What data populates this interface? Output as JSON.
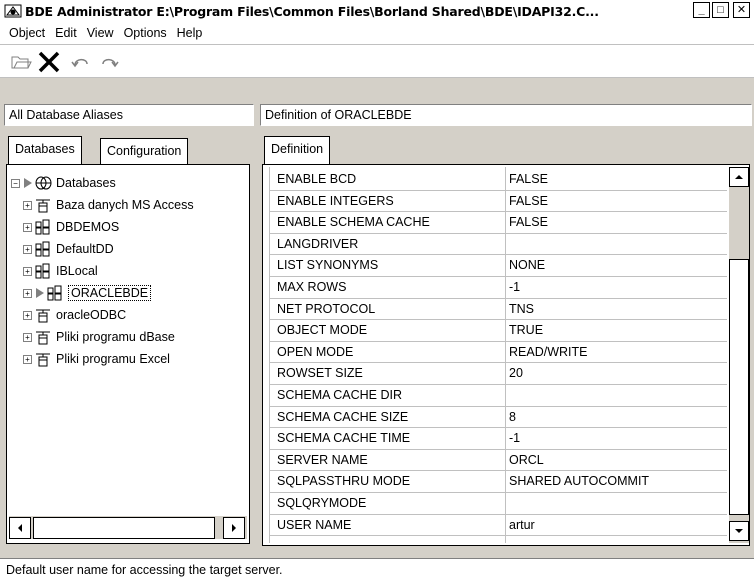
{
  "window": {
    "title": "BDE Administrator  E:\\Program Files\\Common Files\\Borland Shared\\BDE\\IDAPI32.C...",
    "min_label": "_",
    "max_label": "□",
    "close_label": "✕"
  },
  "menu": {
    "items": [
      {
        "label": "Object"
      },
      {
        "label": "Edit"
      },
      {
        "label": "View"
      },
      {
        "label": "Options"
      },
      {
        "label": "Help"
      }
    ]
  },
  "toolbar": {
    "buttons": [
      {
        "icon": "open-folder-icon"
      },
      {
        "icon": "delete-x-icon"
      },
      {
        "icon": "undo-icon"
      },
      {
        "icon": "redo-icon"
      }
    ]
  },
  "left": {
    "header": "All Database Aliases",
    "tabs": [
      {
        "label": "Databases"
      },
      {
        "label": "Configuration"
      }
    ],
    "tree": {
      "root": "Databases",
      "items": [
        {
          "label": "Baza danych MS Access",
          "icon": "odbc-db-icon"
        },
        {
          "label": "DBDEMOS",
          "icon": "native-db-icon"
        },
        {
          "label": "DefaultDD",
          "icon": "native-db-icon"
        },
        {
          "label": "IBLocal",
          "icon": "native-db-icon"
        },
        {
          "label": "ORACLEBDE",
          "icon": "native-db-icon",
          "selected": true
        },
        {
          "label": "oracleODBC",
          "icon": "odbc-db-icon"
        },
        {
          "label": "Pliki programu dBase",
          "icon": "odbc-db-icon"
        },
        {
          "label": "Pliki programu Excel",
          "icon": "odbc-db-icon"
        }
      ]
    }
  },
  "right": {
    "header": "Definition of ORACLEBDE",
    "tabs": [
      {
        "label": "Definition"
      }
    ],
    "grid": [
      {
        "name": "ENABLE BCD",
        "value": "FALSE"
      },
      {
        "name": "ENABLE INTEGERS",
        "value": "FALSE"
      },
      {
        "name": "ENABLE SCHEMA CACHE",
        "value": "FALSE"
      },
      {
        "name": "LANGDRIVER",
        "value": ""
      },
      {
        "name": "LIST SYNONYMS",
        "value": "NONE"
      },
      {
        "name": "MAX ROWS",
        "value": "-1"
      },
      {
        "name": "NET PROTOCOL",
        "value": "TNS"
      },
      {
        "name": "OBJECT MODE",
        "value": "TRUE"
      },
      {
        "name": "OPEN MODE",
        "value": "READ/WRITE"
      },
      {
        "name": "ROWSET SIZE",
        "value": "20"
      },
      {
        "name": "SCHEMA CACHE DIR",
        "value": ""
      },
      {
        "name": "SCHEMA CACHE SIZE",
        "value": "8"
      },
      {
        "name": "SCHEMA CACHE TIME",
        "value": "-1"
      },
      {
        "name": "SERVER NAME",
        "value": "ORCL"
      },
      {
        "name": "SQLPASSTHRU MODE",
        "value": "SHARED AUTOCOMMIT"
      },
      {
        "name": "SQLQRYMODE",
        "value": ""
      },
      {
        "name": "USER NAME",
        "value": "artur"
      }
    ]
  },
  "status": {
    "text": "Default user name for accessing the target server."
  }
}
